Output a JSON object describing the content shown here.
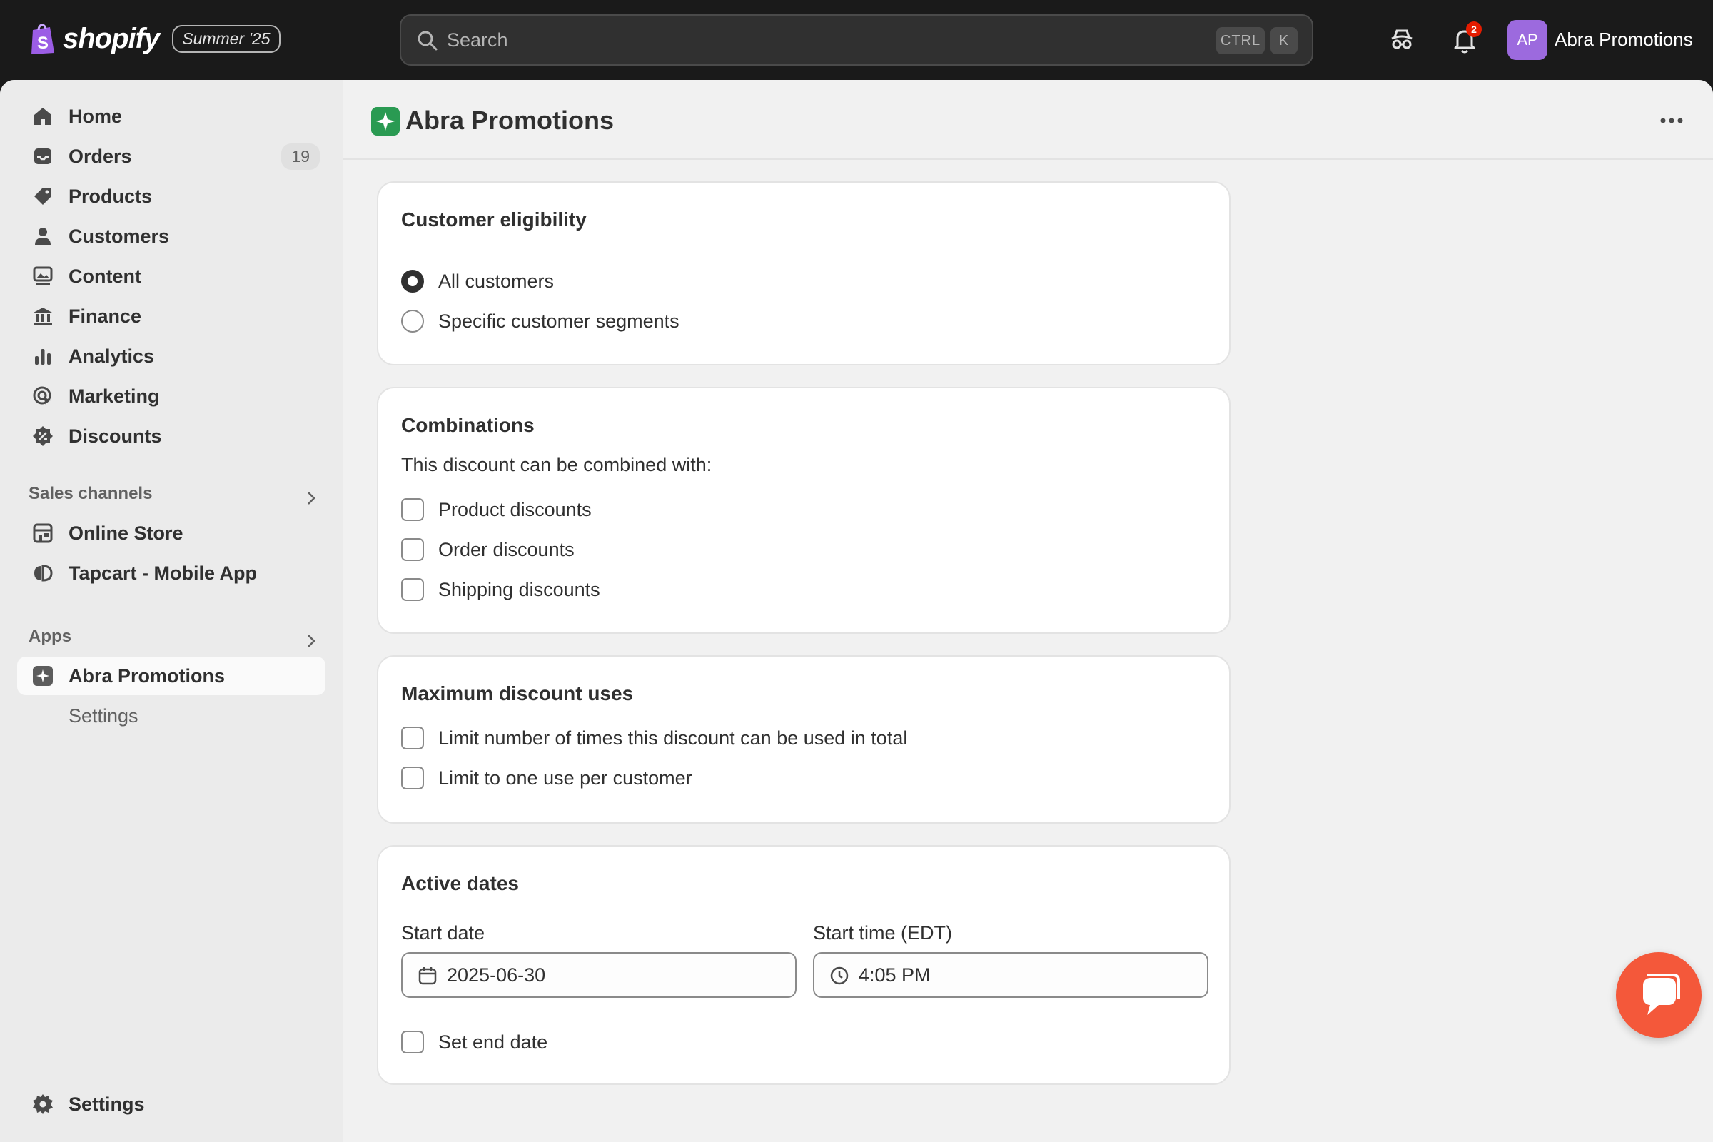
{
  "topbar": {
    "brand": "shopify",
    "edition": "Summer '25",
    "search_placeholder": "Search",
    "kbd_ctrl": "CTRL",
    "kbd_k": "K",
    "notification_count": "2",
    "avatar_initials": "AP",
    "store_name": "Abra Promotions"
  },
  "sidebar": {
    "items": [
      {
        "label": "Home",
        "icon": "home-icon"
      },
      {
        "label": "Orders",
        "icon": "orders-icon",
        "count": "19"
      },
      {
        "label": "Products",
        "icon": "tag-icon"
      },
      {
        "label": "Customers",
        "icon": "person-icon"
      },
      {
        "label": "Content",
        "icon": "content-icon"
      },
      {
        "label": "Finance",
        "icon": "bank-icon"
      },
      {
        "label": "Analytics",
        "icon": "bar-chart-icon"
      },
      {
        "label": "Marketing",
        "icon": "target-icon"
      },
      {
        "label": "Discounts",
        "icon": "discount-icon"
      }
    ],
    "sales_channels_heading": "Sales channels",
    "channels": [
      {
        "label": "Online Store",
        "icon": "store-icon"
      },
      {
        "label": "Tapcart - Mobile App",
        "icon": "tapcart-icon"
      }
    ],
    "apps_heading": "Apps",
    "apps": [
      {
        "label": "Abra Promotions",
        "icon": "abra-icon"
      }
    ],
    "app_sub_settings": "Settings",
    "settings_label": "Settings"
  },
  "page": {
    "title": "Abra Promotions"
  },
  "eligibility": {
    "title": "Customer eligibility",
    "options": [
      "All customers",
      "Specific customer segments"
    ],
    "selected": "All customers"
  },
  "combinations": {
    "title": "Combinations",
    "description": "This discount can be combined with:",
    "options": [
      "Product discounts",
      "Order discounts",
      "Shipping discounts"
    ]
  },
  "max_uses": {
    "title": "Maximum discount uses",
    "options": [
      "Limit number of times this discount can be used in total",
      "Limit to one use per customer"
    ]
  },
  "active_dates": {
    "title": "Active dates",
    "start_date_label": "Start date",
    "start_date_value": "2025-06-30",
    "start_time_label": "Start time (EDT)",
    "start_time_value": "4:05 PM",
    "end_date_option": "Set end date"
  },
  "colors": {
    "accent": "#2a9a52",
    "chat": "#f4583a",
    "avatar": "#9c6ade",
    "notification": "#e51c00"
  }
}
